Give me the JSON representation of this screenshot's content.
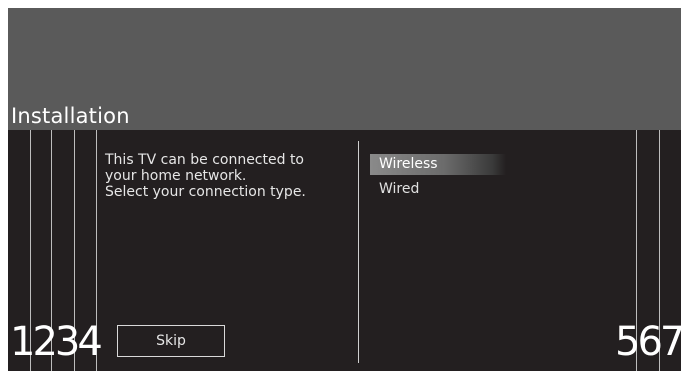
{
  "header": {
    "title": "Installation"
  },
  "description": {
    "lines": [
      "This TV can be connected to",
      "your home network.",
      "Select your connection type."
    ]
  },
  "options": [
    {
      "label": "Wireless",
      "selected": true
    },
    {
      "label": "Wired",
      "selected": false
    }
  ],
  "buttons": {
    "skip_label": "Skip"
  },
  "callouts": {
    "left": "1234",
    "right": "567"
  },
  "colors": {
    "background": "#231f20",
    "header": "#5a5a5a",
    "text": "#e6e6e6",
    "highlight": "#8a8a8a"
  }
}
